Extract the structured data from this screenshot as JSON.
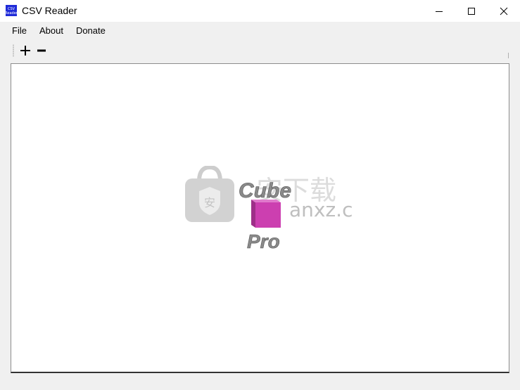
{
  "window": {
    "title": "CSV Reader",
    "icon_text_line1": "CSV",
    "icon_text_line2": "Reader"
  },
  "menu": {
    "items": [
      {
        "label": "File"
      },
      {
        "label": "About"
      },
      {
        "label": "Donate"
      }
    ]
  },
  "toolbar": {
    "add_icon": "plus-icon",
    "remove_icon": "minus-icon"
  },
  "watermark": {
    "text_top": "Cube",
    "text_bottom": "Pro",
    "site_text": "anxz.com",
    "shield_char": "安",
    "cn_text": "安下载",
    "accent": "#cc3fb0"
  },
  "colors": {
    "app_icon_bg": "#1f2bd8",
    "background": "#f0f0f0",
    "grid_bg": "#ffffff"
  }
}
